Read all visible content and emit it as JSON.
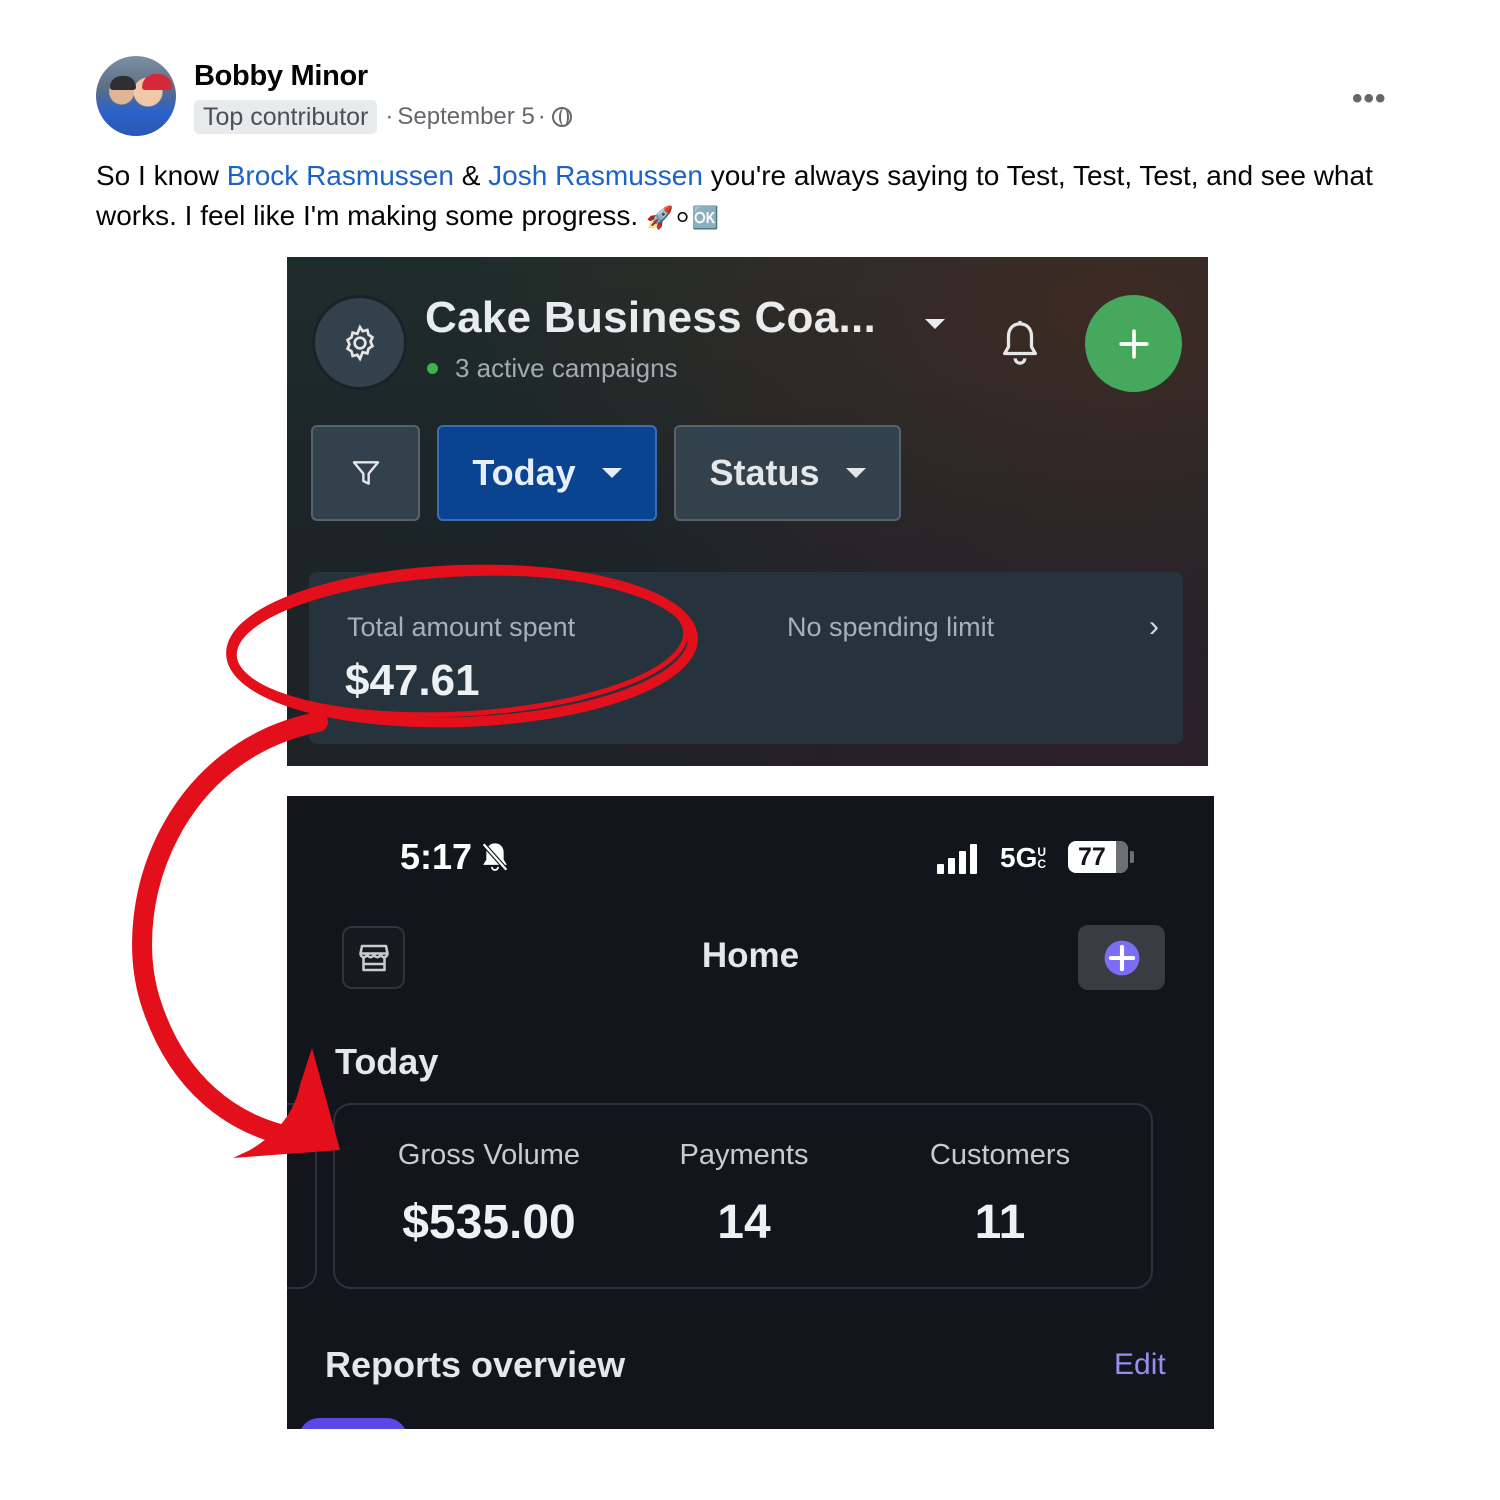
{
  "post": {
    "author": "Bobby Minor",
    "badge": "Top contributor",
    "separator": "·",
    "date": "September 5",
    "date_sep": "·",
    "more": "•••",
    "text_1": "So I know ",
    "mention_1": "Brock Rasmussen",
    "text_2": " & ",
    "mention_2": "Josh Rasmussen",
    "text_3": " you're always saying to Test, Test, Test, and see what works. I feel like I'm making some progress. ",
    "emojis": "🚀⚪🆗",
    "icons": [
      "avatar",
      "globe-icon",
      "more-icon"
    ]
  },
  "ads_manager": {
    "account_name": "Cake Business Coa...",
    "active_status": "3 active campaigns",
    "filters": {
      "today": "Today",
      "status": "Status"
    },
    "spend": {
      "label": "Total amount spent",
      "value": "$47.61",
      "limit": "No spending limit",
      "chevron": "›"
    },
    "colors": {
      "accent_green": "#46a85c",
      "today_blue": "#0a4491"
    },
    "icons": [
      "gear-icon",
      "chevron-down-icon",
      "bell-icon",
      "plus-icon",
      "filter-icon",
      "chevron-right-icon"
    ]
  },
  "phone_app": {
    "status_bar": {
      "time": "5:17",
      "network": "5G",
      "network_suffix": "UC",
      "battery": "77",
      "battery_level": 0.77
    },
    "header": {
      "title": "Home"
    },
    "today": {
      "heading": "Today",
      "stats": [
        {
          "label": "Gross Volume",
          "value": "$535.00"
        },
        {
          "label": "Payments",
          "value": "14"
        },
        {
          "label": "Customers",
          "value": "11"
        }
      ]
    },
    "reports": {
      "heading": "Reports overview",
      "edit": "Edit"
    },
    "colors": {
      "accent_purple": "#5b46e6",
      "edit_purple": "#9a8cf0"
    },
    "icons": [
      "bell-slash-icon",
      "signal-icon",
      "battery-icon",
      "store-icon",
      "plus-circle-icon"
    ]
  },
  "annotation": {
    "color": "#e3101c",
    "shapes": [
      "ellipse",
      "curved-arrow"
    ]
  }
}
